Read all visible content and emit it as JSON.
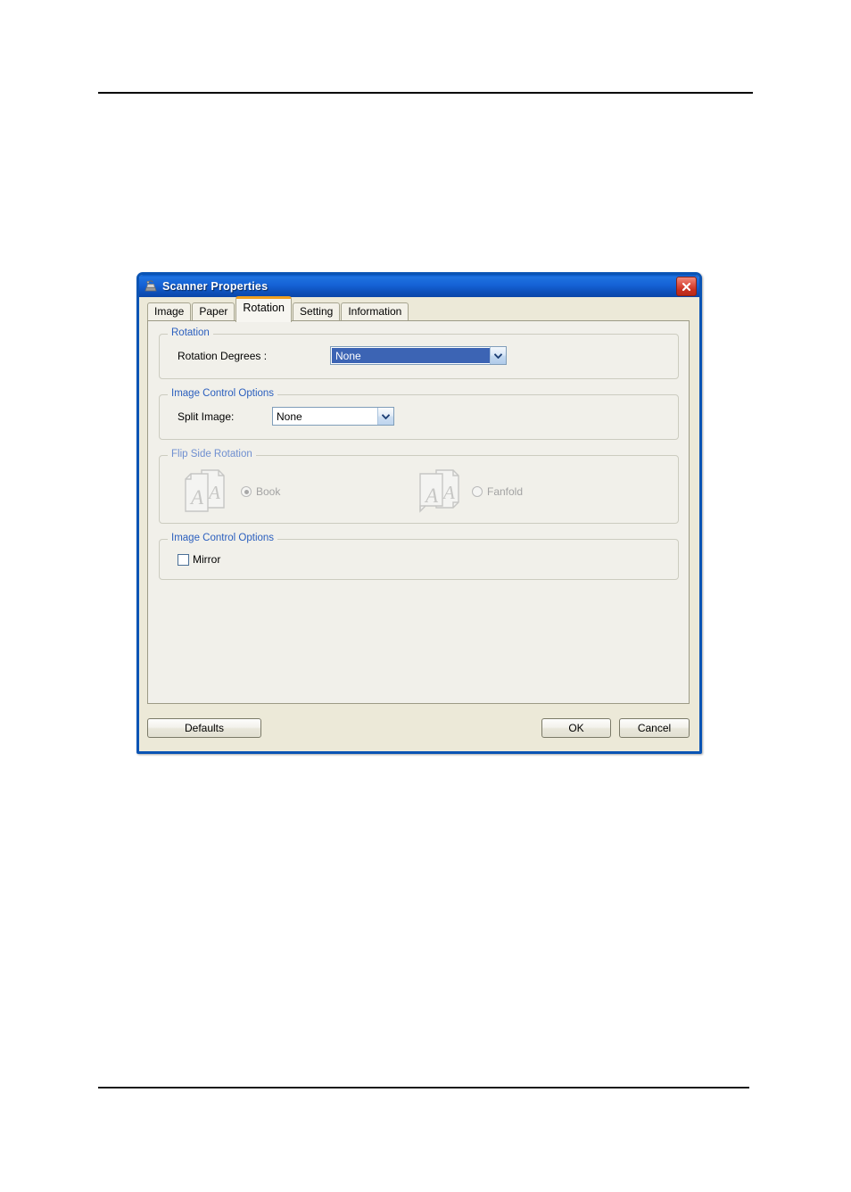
{
  "window": {
    "title": "Scanner Properties",
    "icon": "scanner-icon",
    "close_label": "✕",
    "accent_titlebar": "#1562d6",
    "accent_close": "#c8301f",
    "dialog_background": "#ece9d8",
    "tab_page_background": "#f1f0ea",
    "group_legend_color": "#2b5fbe",
    "selected_tab_accent": "#f0a020"
  },
  "tabs": [
    {
      "label": "Image",
      "selected": false
    },
    {
      "label": "Paper",
      "selected": false
    },
    {
      "label": "Rotation",
      "selected": true
    },
    {
      "label": "Setting",
      "selected": false
    },
    {
      "label": "Information",
      "selected": false
    }
  ],
  "groups": {
    "rotation": {
      "legend": "Rotation",
      "rotation_degrees": {
        "label": "Rotation Degrees :",
        "value": "None",
        "focused": true
      }
    },
    "image_control_options_split": {
      "legend": "Image Control Options",
      "split_image": {
        "label": "Split Image:",
        "value": "None",
        "focused": false
      }
    },
    "flip_side_rotation": {
      "legend": "Flip Side Rotation",
      "disabled": true,
      "options": [
        {
          "label": "Book",
          "selected": true,
          "icon": "book-pages-icon"
        },
        {
          "label": "Fanfold",
          "selected": false,
          "icon": "fanfold-pages-icon"
        }
      ]
    },
    "image_control_options_mirror": {
      "legend": "Image Control Options",
      "mirror": {
        "label": "Mirror",
        "checked": false
      }
    }
  },
  "footer": {
    "defaults_label": "Defaults",
    "ok_label": "OK",
    "cancel_label": "Cancel"
  }
}
